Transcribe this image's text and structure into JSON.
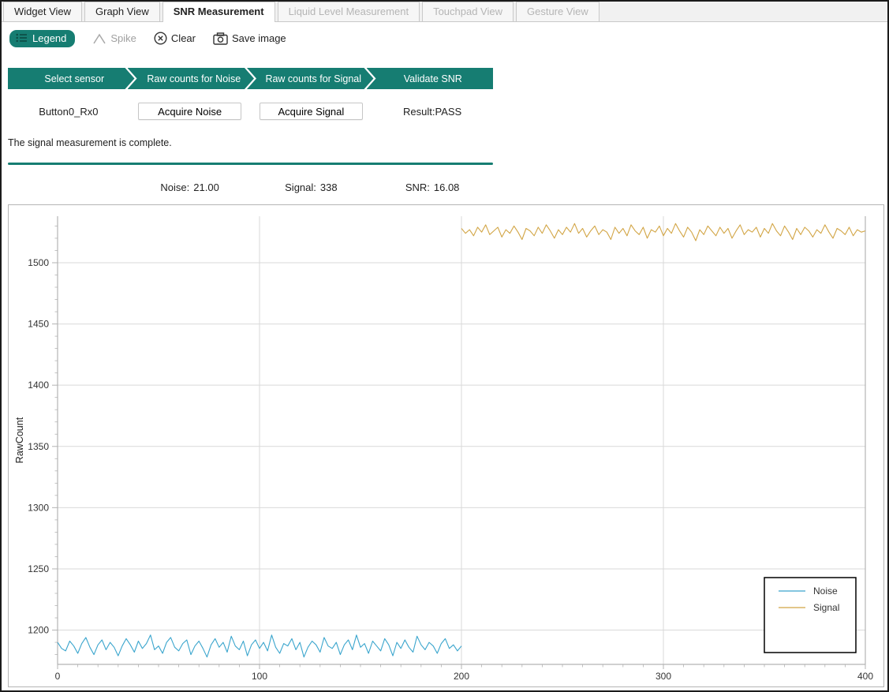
{
  "tabs": {
    "items": [
      {
        "label": "Widget View",
        "state": "enabled"
      },
      {
        "label": "Graph View",
        "state": "enabled"
      },
      {
        "label": "SNR Measurement",
        "state": "active"
      },
      {
        "label": "Liquid Level Measurement",
        "state": "disabled"
      },
      {
        "label": "Touchpad View",
        "state": "disabled"
      },
      {
        "label": "Gesture View",
        "state": "disabled"
      }
    ]
  },
  "toolbar": {
    "legend_label": "Legend",
    "spike_label": "Spike",
    "clear_label": "Clear",
    "save_image_label": "Save image"
  },
  "wizard": {
    "steps": [
      "Select sensor",
      "Raw counts for Noise",
      "Raw counts for Signal",
      "Validate SNR"
    ]
  },
  "controls": {
    "sensor_name": "Button0_Rx0",
    "acquire_noise_label": "Acquire Noise",
    "acquire_signal_label": "Acquire Signal",
    "result_text": "Result:PASS"
  },
  "status": {
    "message": "The signal measurement is complete."
  },
  "metrics": {
    "noise_label": "Noise:",
    "noise_value": "21.00",
    "signal_label": "Signal:",
    "signal_value": "338",
    "snr_label": "SNR:",
    "snr_value": "16.08"
  },
  "colors": {
    "accent": "#167d72",
    "noise_line": "#3aa5cd",
    "signal_line": "#d2a545",
    "grid": "#d9d9d9",
    "axis": "#b3b3b3",
    "tick_text": "#333333"
  },
  "chart_data": {
    "type": "line",
    "title": "",
    "xlabel": "",
    "ylabel": "RawCount",
    "xlim": [
      0,
      400
    ],
    "ylim": [
      1172,
      1538
    ],
    "x_major_ticks": [
      0,
      100,
      200,
      300,
      400
    ],
    "y_major_ticks": [
      1200,
      1250,
      1300,
      1350,
      1400,
      1450,
      1500
    ],
    "minor_tick_step_x": 10,
    "minor_tick_step_y": 10,
    "grid": true,
    "legend": {
      "position": "bottom-right",
      "entries": [
        {
          "name": "Noise",
          "color": "#3aa5cd"
        },
        {
          "name": "Signal",
          "color": "#d2a545"
        }
      ]
    },
    "series": [
      {
        "name": "Noise",
        "color": "#3aa5cd",
        "x_start": 0,
        "x_step": 2,
        "values": [
          1190,
          1185,
          1183,
          1191,
          1187,
          1181,
          1189,
          1194,
          1186,
          1180,
          1188,
          1192,
          1184,
          1190,
          1186,
          1179,
          1187,
          1193,
          1188,
          1182,
          1191,
          1185,
          1189,
          1196,
          1184,
          1187,
          1181,
          1190,
          1194,
          1186,
          1183,
          1189,
          1192,
          1180,
          1187,
          1191,
          1185,
          1178,
          1188,
          1193,
          1186,
          1190,
          1182,
          1195,
          1187,
          1184,
          1191,
          1179,
          1188,
          1192,
          1185,
          1190,
          1183,
          1196,
          1186,
          1181,
          1189,
          1187,
          1193,
          1184,
          1190,
          1178,
          1186,
          1191,
          1188,
          1182,
          1194,
          1187,
          1185,
          1190,
          1180,
          1188,
          1192,
          1184,
          1196,
          1186,
          1189,
          1181,
          1191,
          1187,
          1183,
          1193,
          1188,
          1179,
          1190,
          1185,
          1192,
          1186,
          1182,
          1195,
          1188,
          1184,
          1190,
          1187,
          1181,
          1189,
          1193,
          1185,
          1188,
          1183,
          1187
        ]
      },
      {
        "name": "Signal",
        "color": "#d2a545",
        "x_start": 200,
        "x_step": 2,
        "values": [
          1528,
          1524,
          1527,
          1522,
          1529,
          1525,
          1531,
          1523,
          1526,
          1529,
          1521,
          1527,
          1524,
          1530,
          1525,
          1519,
          1528,
          1526,
          1522,
          1529,
          1524,
          1531,
          1526,
          1520,
          1527,
          1523,
          1529,
          1525,
          1532,
          1524,
          1528,
          1521,
          1526,
          1530,
          1523,
          1527,
          1525,
          1519,
          1529,
          1524,
          1528,
          1522,
          1531,
          1526,
          1523,
          1529,
          1520,
          1527,
          1525,
          1530,
          1522,
          1528,
          1524,
          1532,
          1526,
          1521,
          1529,
          1525,
          1518,
          1527,
          1523,
          1530,
          1526,
          1522,
          1529,
          1524,
          1528,
          1520,
          1526,
          1531,
          1523,
          1527,
          1525,
          1529,
          1521,
          1528,
          1524,
          1532,
          1526,
          1522,
          1530,
          1525,
          1519,
          1528,
          1523,
          1529,
          1526,
          1521,
          1527,
          1524,
          1531,
          1525,
          1520,
          1528,
          1526,
          1523,
          1529,
          1522,
          1527,
          1525,
          1526
        ]
      }
    ]
  }
}
